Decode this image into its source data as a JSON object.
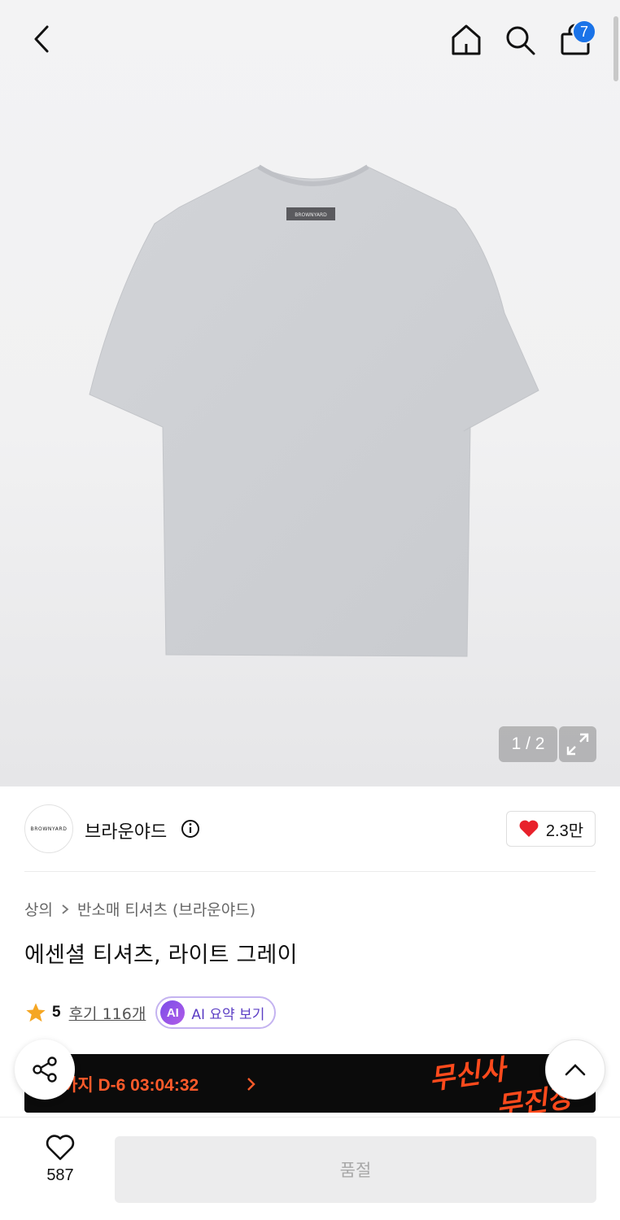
{
  "header": {
    "cart_badge": "7",
    "icons": [
      "back-icon",
      "home-icon",
      "search-icon",
      "shopping-bag-icon"
    ]
  },
  "gallery": {
    "image_label": "BROWNYARD",
    "page_indicator": "1 / 2"
  },
  "brand": {
    "logo_text": "BROWNYARD",
    "name": "브라운야드",
    "like_count": "2.3만"
  },
  "product": {
    "breadcrumb": [
      "상의",
      "반소매 티셔츠 (브라운야드)"
    ],
    "title": "에센셜 티셔츠, 라이트 그레이",
    "rating": "5",
    "review_link": "후기 116개",
    "ai_badge": "AI",
    "ai_label": "AI 요약 보기"
  },
  "promo": {
    "text": "무진장까지 D-6 03:04:32",
    "visible_text": "까지 D-6 03:04:32",
    "art_line1": "무신사",
    "art_line2": "무진장"
  },
  "bottom": {
    "wish_count": "587",
    "soldout_label": "품절"
  },
  "colors": {
    "cart_badge": "#1a73e8",
    "heart": "#e8212b",
    "promo_text": "#ff5a2a",
    "star": "#f5a623",
    "ai_accent": "#7b4ee8"
  }
}
